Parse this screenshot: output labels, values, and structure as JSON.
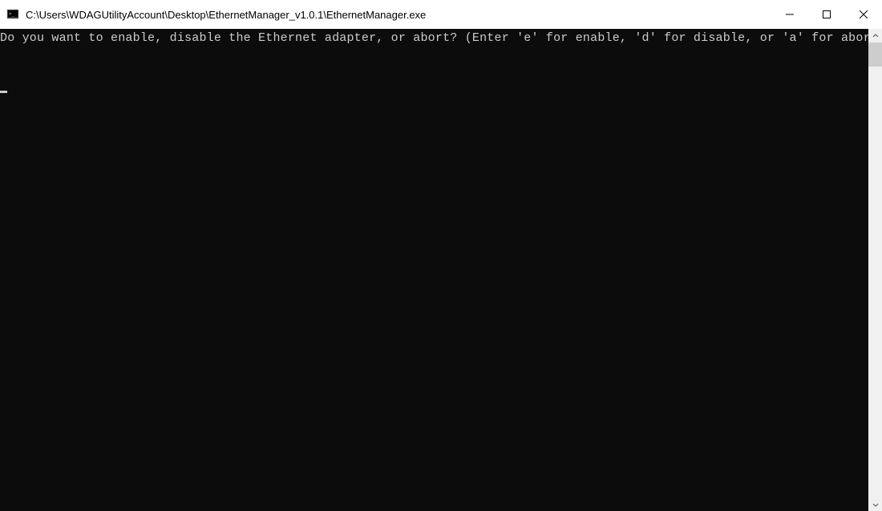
{
  "window": {
    "title": "C:\\Users\\WDAGUtilityAccount\\Desktop\\EthernetManager_v1.0.1\\EthernetManager.exe"
  },
  "console": {
    "prompt": "Do you want to enable, disable the Ethernet adapter, or abort? (Enter 'e' for enable, 'd' for disable, or 'a' for abort)"
  }
}
